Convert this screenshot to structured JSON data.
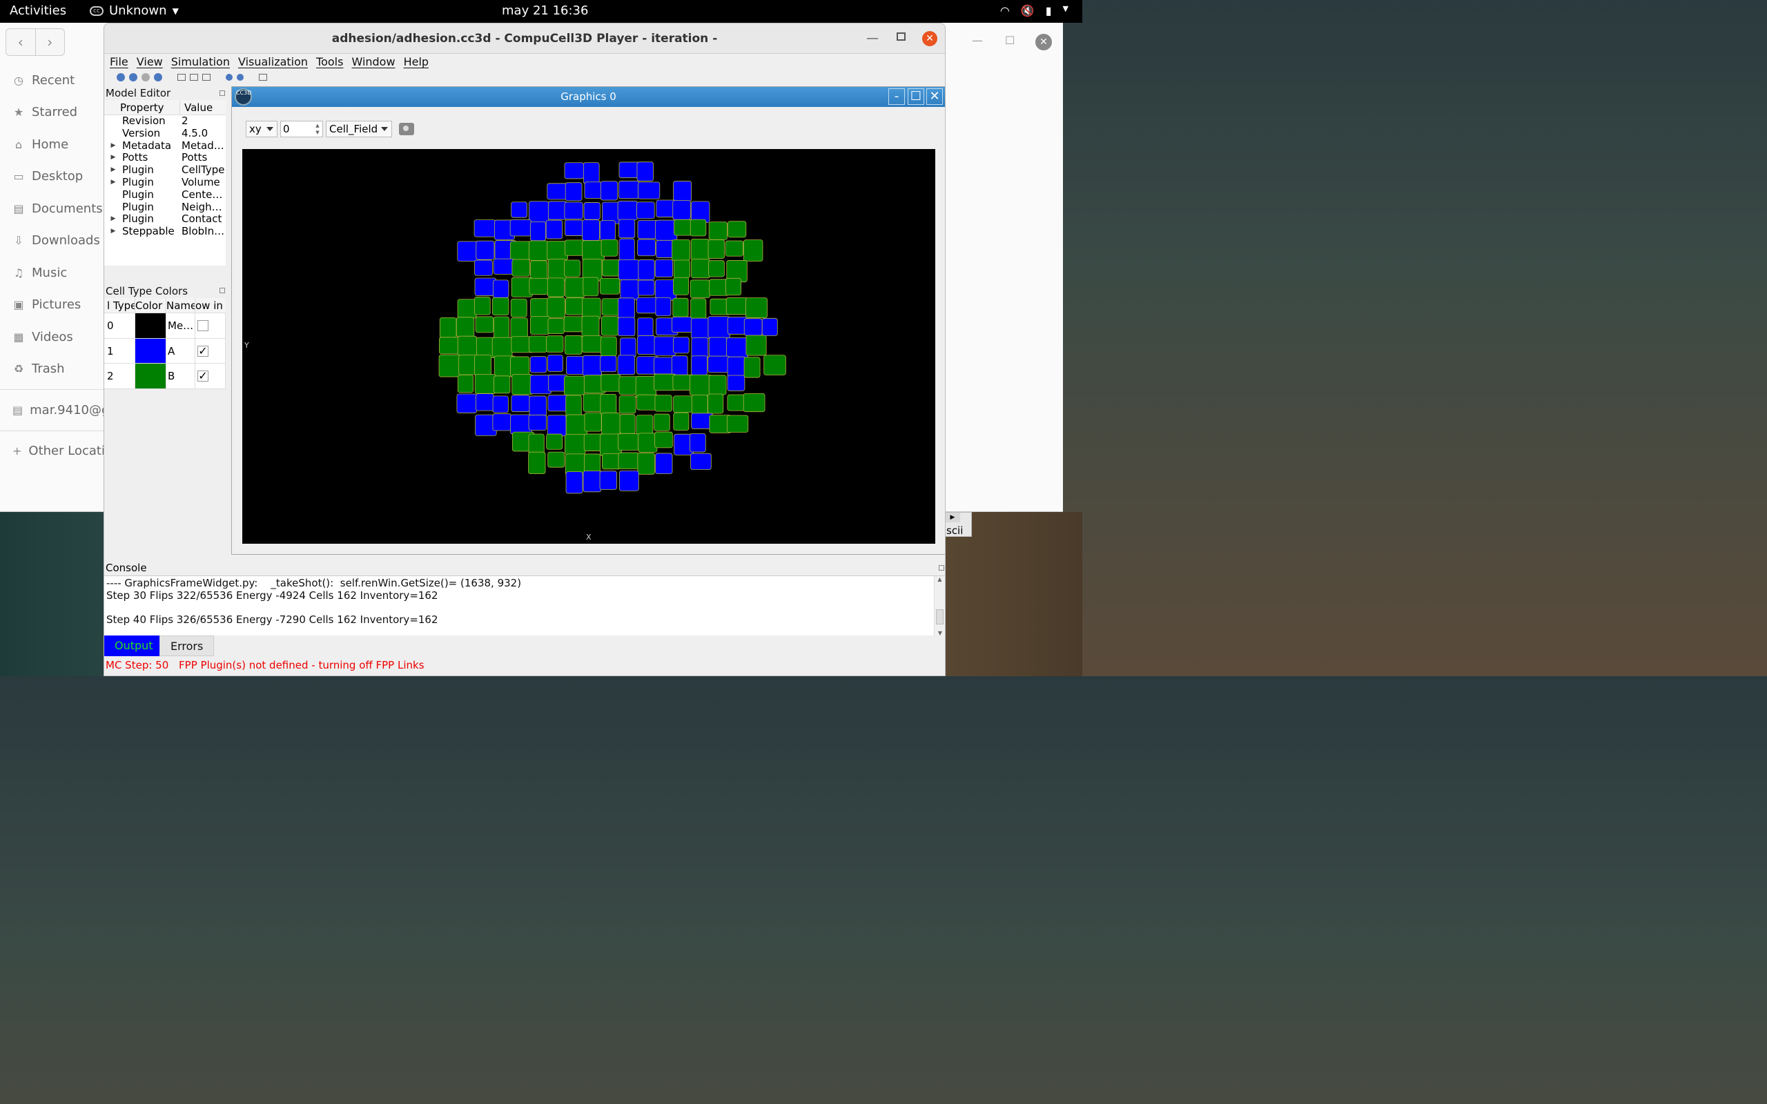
{
  "topbar": {
    "activities": "Activities",
    "app_name": "Unknown",
    "clock": "may 21  16:36"
  },
  "files": {
    "sidebar": [
      {
        "label": "Recent",
        "icon": "clock-icon"
      },
      {
        "label": "Starred",
        "icon": "star-icon"
      },
      {
        "label": "Home",
        "icon": "home-icon"
      },
      {
        "label": "Desktop",
        "icon": "desktop-icon"
      },
      {
        "label": "Documents",
        "icon": "documents-icon"
      },
      {
        "label": "Downloads",
        "icon": "downloads-icon"
      },
      {
        "label": "Music",
        "icon": "music-icon"
      },
      {
        "label": "Pictures",
        "icon": "pictures-icon"
      },
      {
        "label": "Videos",
        "icon": "videos-icon"
      },
      {
        "label": "Trash",
        "icon": "trash-icon"
      }
    ],
    "account": "mar.9410@g",
    "other_locations": "Other Locatio"
  },
  "window": {
    "title": "adhesion/adhesion.cc3d - CompuCell3D Player - iteration -",
    "menus": [
      "File",
      "View",
      "Simulation",
      "Visualization",
      "Tools",
      "Window",
      "Help"
    ]
  },
  "model_editor": {
    "title": "Model Editor",
    "col_property": "Property",
    "col_value": "Value",
    "rows": [
      {
        "expand": "",
        "property": "Revision",
        "value": "2"
      },
      {
        "expand": "",
        "property": "Version",
        "value": "4.5.0"
      },
      {
        "expand": "▶",
        "property": "Metadata",
        "value": "Metad…"
      },
      {
        "expand": "▶",
        "property": "Potts",
        "value": "Potts"
      },
      {
        "expand": "▶",
        "property": "Plugin",
        "value": "CellType"
      },
      {
        "expand": "▶",
        "property": "Plugin",
        "value": "Volume"
      },
      {
        "expand": "",
        "property": "Plugin",
        "value": "Cente…"
      },
      {
        "expand": "",
        "property": "Plugin",
        "value": "Neigh…"
      },
      {
        "expand": "▶",
        "property": "Plugin",
        "value": "Contact"
      },
      {
        "expand": "▶",
        "property": "Steppable",
        "value": "BlobIn…"
      }
    ]
  },
  "cell_type_colors": {
    "title": "Cell Type Colors",
    "headers": [
      "l Type",
      "Color",
      "Name",
      "ow in"
    ],
    "rows": [
      {
        "type": "0",
        "color": "#000000",
        "name": "Me…",
        "checked": ""
      },
      {
        "type": "1",
        "color": "#0000ff",
        "name": "A",
        "checked": "✓"
      },
      {
        "type": "2",
        "color": "#008000",
        "name": "B",
        "checked": "✓"
      }
    ]
  },
  "graphics": {
    "title": "Graphics 0",
    "logo": "CC3D",
    "projection": "xy",
    "slice": "0",
    "field": "Cell_Field",
    "axis_x": "X",
    "axis_y": "Y",
    "colors": {
      "A": "#0000ff",
      "B": "#008000",
      "border": "#b0b040"
    }
  },
  "console": {
    "title": "Console",
    "lines": [
      "---- GraphicsFrameWidget.py:    _takeShot():  self.renWin.GetSize()= (1638, 932)",
      "Step 30 Flips 322/65536 Energy -4924 Cells 162 Inventory=162",
      "",
      "Step 40 Flips 326/65536 Energy -7290 Cells 162 Inventory=162"
    ],
    "tab_output": "Output",
    "tab_errors": "Errors"
  },
  "status": {
    "mc_step": "MC Step: 50",
    "message": "FPP Plugin(s) not defined - turning off FPP Links"
  },
  "bg_widget": "scii"
}
